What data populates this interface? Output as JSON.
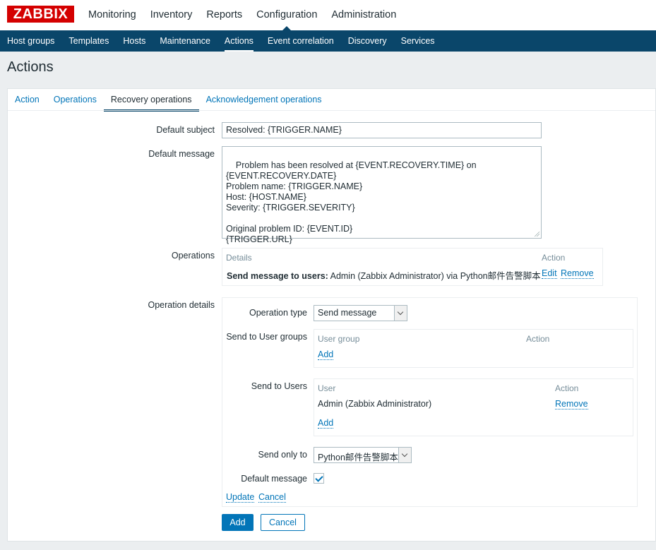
{
  "app": {
    "logo": "ZABBIX"
  },
  "top_menu": [
    "Monitoring",
    "Inventory",
    "Reports",
    "Configuration",
    "Administration"
  ],
  "sub_menu": [
    "Host groups",
    "Templates",
    "Hosts",
    "Maintenance",
    "Actions",
    "Event correlation",
    "Discovery",
    "Services"
  ],
  "page": {
    "title": "Actions"
  },
  "tabs": [
    "Action",
    "Operations",
    "Recovery operations",
    "Acknowledgement operations"
  ],
  "form": {
    "default_subject_label": "Default subject",
    "default_subject_value": "Resolved: {TRIGGER.NAME}",
    "default_message_label": "Default message",
    "default_message_value": "Problem has been resolved at {EVENT.RECOVERY.TIME} on\n{EVENT.RECOVERY.DATE}\nProblem name: {TRIGGER.NAME}\nHost: {HOST.NAME}\nSeverity: {TRIGGER.SEVERITY}\n\nOriginal problem ID: {EVENT.ID}\n{TRIGGER.URL}",
    "operations_label": "Operations",
    "operations_table": {
      "col_details": "Details",
      "col_action": "Action",
      "row_bold": "Send message to users:",
      "row_text": "Admin (Zabbix Administrator) via Python邮件告警脚本",
      "edit": "Edit",
      "remove": "Remove"
    },
    "operation_details_label": "Operation details",
    "operation_type_label": "Operation type",
    "operation_type_value": "Send message",
    "send_to_groups_label": "Send to User groups",
    "groups_table": {
      "col_group": "User group",
      "col_action": "Action",
      "add": "Add"
    },
    "send_to_users_label": "Send to Users",
    "users_table": {
      "col_user": "User",
      "col_action": "Action",
      "row_user": "Admin (Zabbix Administrator)",
      "remove": "Remove",
      "add": "Add"
    },
    "send_only_to_label": "Send only to",
    "send_only_to_value": "Python邮件告警脚本",
    "default_message_check_label": "Default message",
    "update": "Update",
    "cancel_link": "Cancel",
    "add_button": "Add",
    "cancel_button": "Cancel"
  }
}
